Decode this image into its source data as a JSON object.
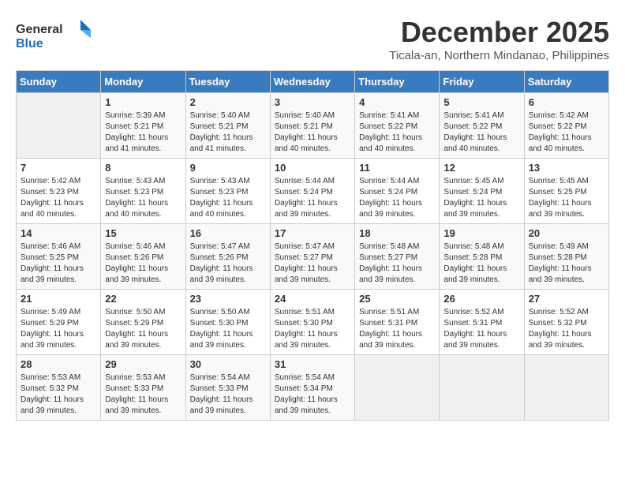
{
  "logo": {
    "text_general": "General",
    "text_blue": "Blue"
  },
  "title": {
    "month": "December 2025",
    "location": "Ticala-an, Northern Mindanao, Philippines"
  },
  "headers": [
    "Sunday",
    "Monday",
    "Tuesday",
    "Wednesday",
    "Thursday",
    "Friday",
    "Saturday"
  ],
  "weeks": [
    [
      {
        "day": "",
        "sunrise": "",
        "sunset": "",
        "daylight": "",
        "empty": true
      },
      {
        "day": "1",
        "sunrise": "Sunrise: 5:39 AM",
        "sunset": "Sunset: 5:21 PM",
        "daylight": "Daylight: 11 hours and 41 minutes."
      },
      {
        "day": "2",
        "sunrise": "Sunrise: 5:40 AM",
        "sunset": "Sunset: 5:21 PM",
        "daylight": "Daylight: 11 hours and 41 minutes."
      },
      {
        "day": "3",
        "sunrise": "Sunrise: 5:40 AM",
        "sunset": "Sunset: 5:21 PM",
        "daylight": "Daylight: 11 hours and 40 minutes."
      },
      {
        "day": "4",
        "sunrise": "Sunrise: 5:41 AM",
        "sunset": "Sunset: 5:22 PM",
        "daylight": "Daylight: 11 hours and 40 minutes."
      },
      {
        "day": "5",
        "sunrise": "Sunrise: 5:41 AM",
        "sunset": "Sunset: 5:22 PM",
        "daylight": "Daylight: 11 hours and 40 minutes."
      },
      {
        "day": "6",
        "sunrise": "Sunrise: 5:42 AM",
        "sunset": "Sunset: 5:22 PM",
        "daylight": "Daylight: 11 hours and 40 minutes."
      }
    ],
    [
      {
        "day": "7",
        "sunrise": "Sunrise: 5:42 AM",
        "sunset": "Sunset: 5:23 PM",
        "daylight": "Daylight: 11 hours and 40 minutes."
      },
      {
        "day": "8",
        "sunrise": "Sunrise: 5:43 AM",
        "sunset": "Sunset: 5:23 PM",
        "daylight": "Daylight: 11 hours and 40 minutes."
      },
      {
        "day": "9",
        "sunrise": "Sunrise: 5:43 AM",
        "sunset": "Sunset: 5:23 PM",
        "daylight": "Daylight: 11 hours and 40 minutes."
      },
      {
        "day": "10",
        "sunrise": "Sunrise: 5:44 AM",
        "sunset": "Sunset: 5:24 PM",
        "daylight": "Daylight: 11 hours and 39 minutes."
      },
      {
        "day": "11",
        "sunrise": "Sunrise: 5:44 AM",
        "sunset": "Sunset: 5:24 PM",
        "daylight": "Daylight: 11 hours and 39 minutes."
      },
      {
        "day": "12",
        "sunrise": "Sunrise: 5:45 AM",
        "sunset": "Sunset: 5:24 PM",
        "daylight": "Daylight: 11 hours and 39 minutes."
      },
      {
        "day": "13",
        "sunrise": "Sunrise: 5:45 AM",
        "sunset": "Sunset: 5:25 PM",
        "daylight": "Daylight: 11 hours and 39 minutes."
      }
    ],
    [
      {
        "day": "14",
        "sunrise": "Sunrise: 5:46 AM",
        "sunset": "Sunset: 5:25 PM",
        "daylight": "Daylight: 11 hours and 39 minutes."
      },
      {
        "day": "15",
        "sunrise": "Sunrise: 5:46 AM",
        "sunset": "Sunset: 5:26 PM",
        "daylight": "Daylight: 11 hours and 39 minutes."
      },
      {
        "day": "16",
        "sunrise": "Sunrise: 5:47 AM",
        "sunset": "Sunset: 5:26 PM",
        "daylight": "Daylight: 11 hours and 39 minutes."
      },
      {
        "day": "17",
        "sunrise": "Sunrise: 5:47 AM",
        "sunset": "Sunset: 5:27 PM",
        "daylight": "Daylight: 11 hours and 39 minutes."
      },
      {
        "day": "18",
        "sunrise": "Sunrise: 5:48 AM",
        "sunset": "Sunset: 5:27 PM",
        "daylight": "Daylight: 11 hours and 39 minutes."
      },
      {
        "day": "19",
        "sunrise": "Sunrise: 5:48 AM",
        "sunset": "Sunset: 5:28 PM",
        "daylight": "Daylight: 11 hours and 39 minutes."
      },
      {
        "day": "20",
        "sunrise": "Sunrise: 5:49 AM",
        "sunset": "Sunset: 5:28 PM",
        "daylight": "Daylight: 11 hours and 39 minutes."
      }
    ],
    [
      {
        "day": "21",
        "sunrise": "Sunrise: 5:49 AM",
        "sunset": "Sunset: 5:29 PM",
        "daylight": "Daylight: 11 hours and 39 minutes."
      },
      {
        "day": "22",
        "sunrise": "Sunrise: 5:50 AM",
        "sunset": "Sunset: 5:29 PM",
        "daylight": "Daylight: 11 hours and 39 minutes."
      },
      {
        "day": "23",
        "sunrise": "Sunrise: 5:50 AM",
        "sunset": "Sunset: 5:30 PM",
        "daylight": "Daylight: 11 hours and 39 minutes."
      },
      {
        "day": "24",
        "sunrise": "Sunrise: 5:51 AM",
        "sunset": "Sunset: 5:30 PM",
        "daylight": "Daylight: 11 hours and 39 minutes."
      },
      {
        "day": "25",
        "sunrise": "Sunrise: 5:51 AM",
        "sunset": "Sunset: 5:31 PM",
        "daylight": "Daylight: 11 hours and 39 minutes."
      },
      {
        "day": "26",
        "sunrise": "Sunrise: 5:52 AM",
        "sunset": "Sunset: 5:31 PM",
        "daylight": "Daylight: 11 hours and 39 minutes."
      },
      {
        "day": "27",
        "sunrise": "Sunrise: 5:52 AM",
        "sunset": "Sunset: 5:32 PM",
        "daylight": "Daylight: 11 hours and 39 minutes."
      }
    ],
    [
      {
        "day": "28",
        "sunrise": "Sunrise: 5:53 AM",
        "sunset": "Sunset: 5:32 PM",
        "daylight": "Daylight: 11 hours and 39 minutes."
      },
      {
        "day": "29",
        "sunrise": "Sunrise: 5:53 AM",
        "sunset": "Sunset: 5:33 PM",
        "daylight": "Daylight: 11 hours and 39 minutes."
      },
      {
        "day": "30",
        "sunrise": "Sunrise: 5:54 AM",
        "sunset": "Sunset: 5:33 PM",
        "daylight": "Daylight: 11 hours and 39 minutes."
      },
      {
        "day": "31",
        "sunrise": "Sunrise: 5:54 AM",
        "sunset": "Sunset: 5:34 PM",
        "daylight": "Daylight: 11 hours and 39 minutes."
      },
      {
        "day": "",
        "sunrise": "",
        "sunset": "",
        "daylight": "",
        "empty": true
      },
      {
        "day": "",
        "sunrise": "",
        "sunset": "",
        "daylight": "",
        "empty": true
      },
      {
        "day": "",
        "sunrise": "",
        "sunset": "",
        "daylight": "",
        "empty": true
      }
    ]
  ]
}
